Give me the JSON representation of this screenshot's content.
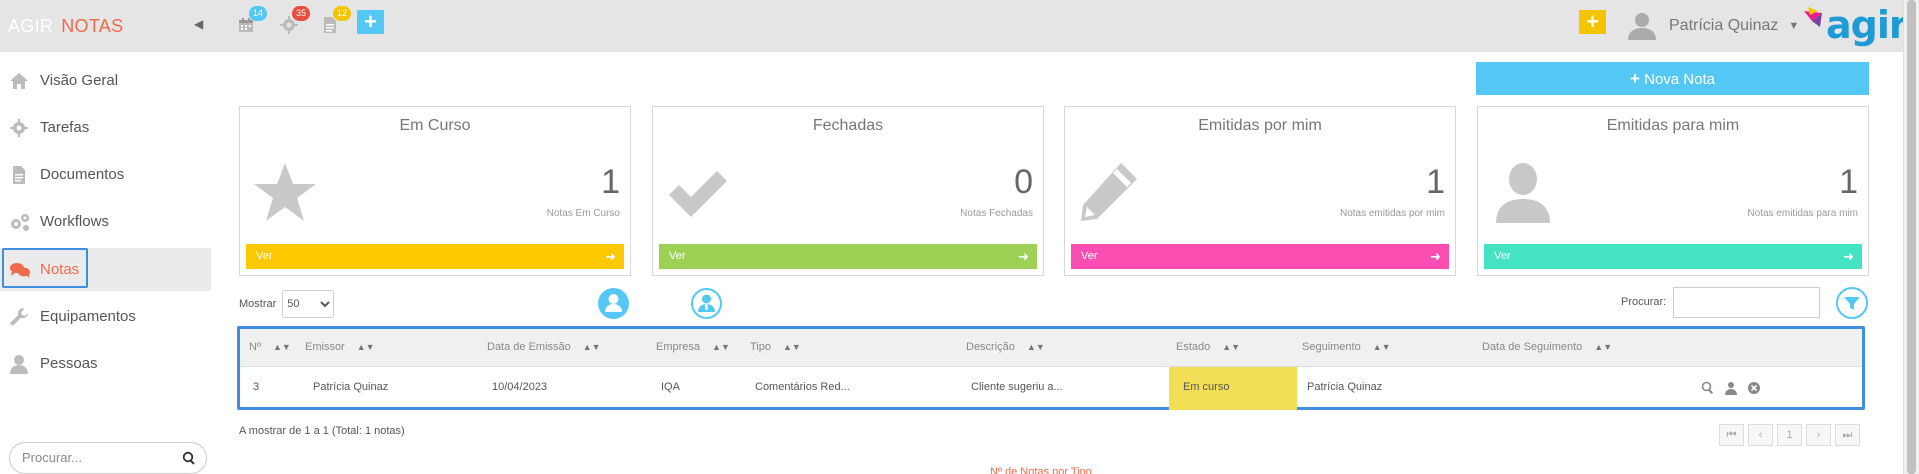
{
  "brand": {
    "part1": "AGIR",
    "part2": "NOTAS"
  },
  "topbar": {
    "badges": {
      "calendar": "14",
      "settings": "35",
      "documents": "12"
    },
    "user_name": "Patrícia Quinaz",
    "logo_text": "agir",
    "colors": {
      "badge_blue": "#54c7f4",
      "badge_red": "#e74c3c",
      "badge_yellow": "#f5c400",
      "plus_yellow": "#f5c400",
      "plus_blue": "#54c7f4"
    }
  },
  "sidebar": {
    "items": [
      {
        "label": "Visão Geral",
        "icon": "home-icon"
      },
      {
        "label": "Tarefas",
        "icon": "gear-icon"
      },
      {
        "label": "Documentos",
        "icon": "document-icon"
      },
      {
        "label": "Workflows",
        "icon": "gears-icon"
      },
      {
        "label": "Notas",
        "icon": "chat-icon",
        "active": true
      },
      {
        "label": "Equipamentos",
        "icon": "wrench-icon"
      },
      {
        "label": "Pessoas",
        "icon": "person-icon"
      }
    ],
    "search_placeholder": "Procurar..."
  },
  "main": {
    "new_note_label": "Nova Nota",
    "cards": [
      {
        "title": "Em Curso",
        "count": "1",
        "subtitle": "Notas Em Curso",
        "bar_label": "Ver",
        "color": "#fcc900",
        "icon": "star-icon"
      },
      {
        "title": "Fechadas",
        "count": "0",
        "subtitle": "Notas Fechadas",
        "bar_label": "Ver",
        "color": "#9cd155",
        "icon": "check-icon"
      },
      {
        "title": "Emitidas por mim",
        "count": "1",
        "subtitle": "Notas emitidas por mim",
        "bar_label": "Ver",
        "color": "#fc4db3",
        "icon": "pencil-icon"
      },
      {
        "title": "Emitidas para mim",
        "count": "1",
        "subtitle": "Notas emitidas para mim",
        "bar_label": "Ver",
        "color": "#43e3c3",
        "icon": "user-icon"
      }
    ],
    "show_label": "Mostrar",
    "show_value": "50",
    "search_label": "Procurar:",
    "table": {
      "headers": [
        "Nº",
        "Emissor",
        "Data de Emissão",
        "Empresa",
        "Tipo",
        "Descrição",
        "Estado",
        "Seguimento",
        "Data de Seguimento"
      ],
      "rows": [
        {
          "num": "3",
          "emissor": "Patrícia Quinaz",
          "data": "10/04/2023",
          "empresa": "IQA",
          "tipo": "Comentários Red...",
          "descricao": "Cliente sugeriu a...",
          "estado": "Em curso",
          "seguimento": "Patrícia Quinaz",
          "data_seguimento": ""
        }
      ],
      "estado_color": "#f3df55"
    },
    "footer": {
      "showing": "A mostrar de 1 a 1 (Total: 1 notas)",
      "page": "1"
    },
    "cut_text": "Nº de Notas por Tipo"
  }
}
